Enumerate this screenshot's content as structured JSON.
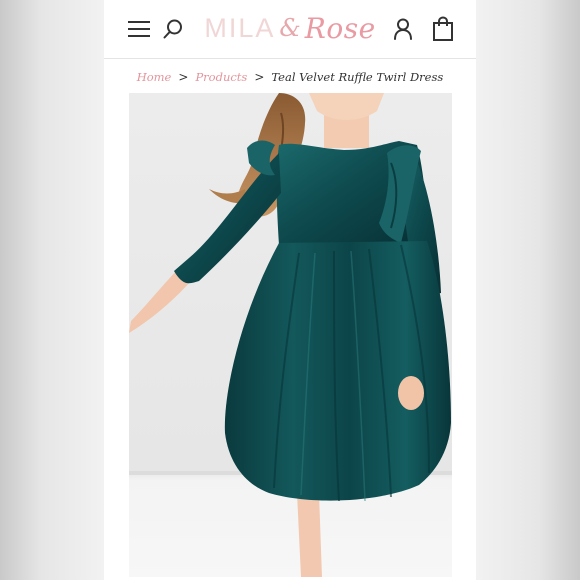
{
  "header": {
    "logo": {
      "part1": "MILA",
      "amp": "&",
      "part2": "Rose"
    },
    "icons": {
      "menu": "hamburger-menu-icon",
      "search": "search-icon",
      "account": "user-account-icon",
      "cart": "shopping-bag-icon"
    }
  },
  "breadcrumb": {
    "items": [
      "Home",
      "Products"
    ],
    "current": "Teal Velvet Ruffle Twirl Dress",
    "separator": ">"
  },
  "product": {
    "image_alt": "Girl wearing teal velvet ruffle dress",
    "dress_color": "#0f4a4e"
  },
  "colors": {
    "accent_pink": "#e3959c",
    "logo_light": "#f1d6d6",
    "text": "#333333"
  }
}
